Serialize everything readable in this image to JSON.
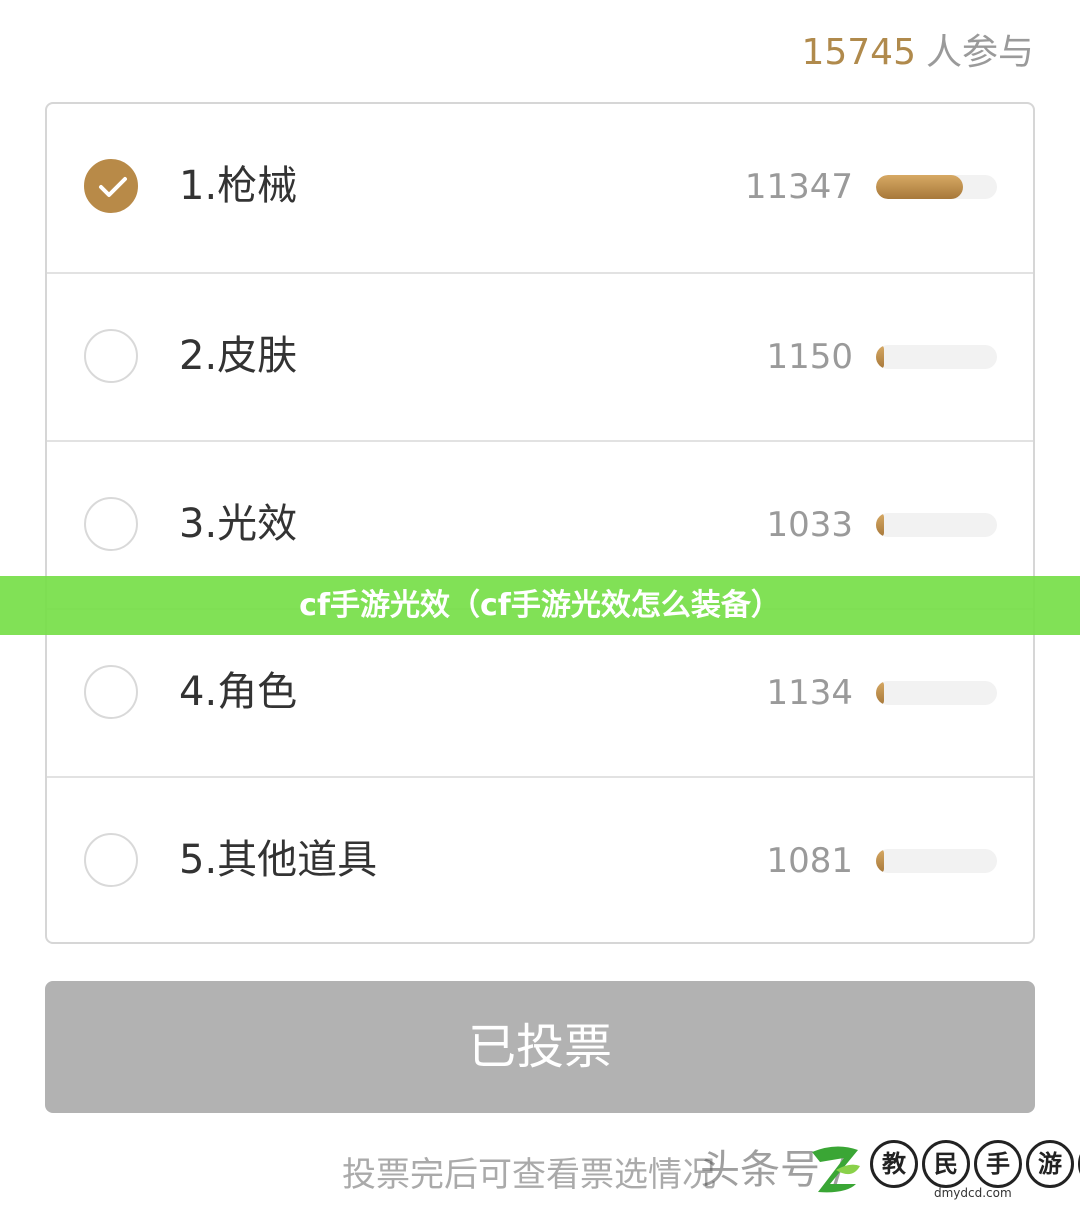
{
  "header": {
    "participant_count": "15745",
    "participant_suffix": "人参与"
  },
  "poll": {
    "options": [
      {
        "label": "1.枪械",
        "votes": "11347",
        "share": 0.72,
        "selected": true
      },
      {
        "label": "2.皮肤",
        "votes": "1150",
        "share": 0.07,
        "selected": false
      },
      {
        "label": "3.光效",
        "votes": "1033",
        "share": 0.07,
        "selected": false
      },
      {
        "label": "4.角色",
        "votes": "1134",
        "share": 0.07,
        "selected": false
      },
      {
        "label": "5.其他道具",
        "votes": "1081",
        "share": 0.07,
        "selected": false
      }
    ]
  },
  "overlay": {
    "banner_title": "cf手游光效（cf手游光效怎么装备）"
  },
  "actions": {
    "vote_button_label": "已投票",
    "hint": "投票完后可查看票选情况"
  },
  "watermarks": {
    "toutiao_text": "头条号 /",
    "logo_chars": [
      "教",
      "民",
      "手",
      "游",
      "网"
    ],
    "logo_domain": "dmydcd.com"
  },
  "colors": {
    "accent": "#b88a48",
    "banner": "#76de48",
    "button_disabled": "#b2b2b2"
  }
}
